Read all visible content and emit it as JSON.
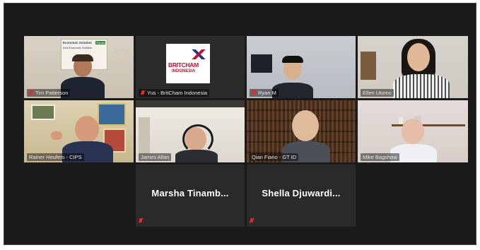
{
  "participants": [
    {
      "name": "Tim Patterson"
    },
    {
      "name": "Yus - BritCham Indonesia",
      "logo_line1": "BRITCHAM",
      "logo_line2": "INDONESIA"
    },
    {
      "name": "Ryan M"
    },
    {
      "name": "Ellen Utomo"
    },
    {
      "name": "Rainer Heufers - CIPS"
    },
    {
      "name": "James Allan"
    },
    {
      "name": "Qian Fiano - GT ID"
    },
    {
      "name": "Mike Bagshaw"
    },
    {
      "name": "Marsha  Tinamb..."
    },
    {
      "name": "Shella  Djuwardi..."
    }
  ],
  "poster": {
    "line1": "Economic Solution",
    "tag": "Forum",
    "line2": "And Economic Solution"
  },
  "colors": {
    "active_speaker": "#8fce3c",
    "muted_mic": "#e02b2b"
  }
}
